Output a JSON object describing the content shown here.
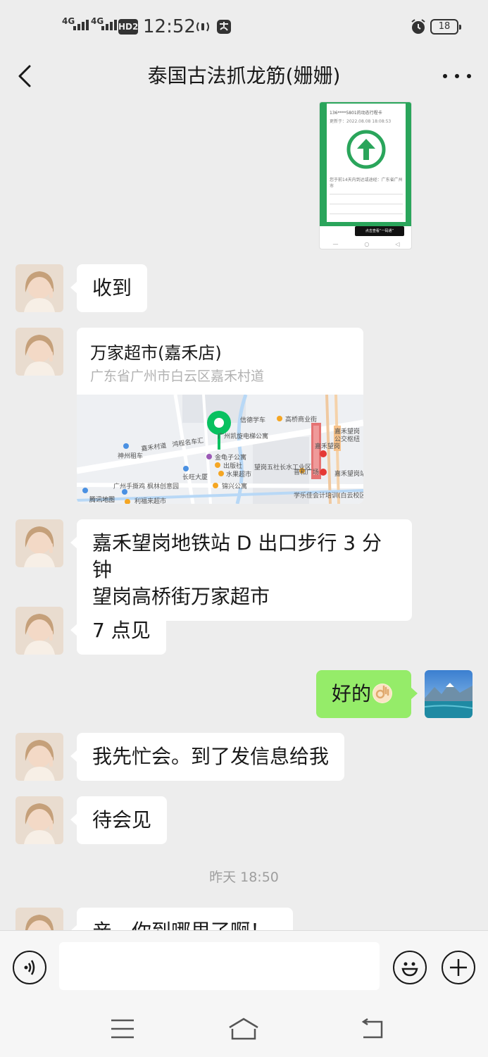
{
  "status_bar": {
    "net1": "4G",
    "net2": "4G",
    "hd": "HD2",
    "time": "12:52",
    "battery": "18"
  },
  "header": {
    "title": "泰国古法抓龙筋(姗姗)"
  },
  "image_card": {
    "line1": "136****5801的动态行程卡",
    "line2": "更新于：2022.08.08 18:08:53",
    "line3": "您于前14天内到达或途经：广东省广州市",
    "footer": "点击查看“一码通”"
  },
  "messages": {
    "m1": "收到",
    "m3": "嘉禾望岗地铁站 D 出口步行 3 分钟",
    "m3b": "望岗高桥街万家超市",
    "m4": "7 点见",
    "m5": "好的",
    "m6": "我先忙会。到了发信息给我",
    "m7": "待会见",
    "m8": "亲，你到哪里了啊！"
  },
  "location": {
    "name": "万家超市(嘉禾店)",
    "address": "广东省广州市白云区嘉禾村道",
    "map_labels": {
      "l1": "信德学车",
      "l2": "高桥商业街",
      "l3": "嘉禾望岗",
      "l4": "公交枢纽",
      "l5": "嘉禾村道",
      "l6": "鸿程名车汇",
      "l7": "神州租车",
      "l8": "广州凯旋电梯公寓",
      "l9": "金龟子公寓",
      "l10": "出版社",
      "l11": "水果超市",
      "l12": "长旺大厦",
      "l13": "望岗五社长水工业区",
      "l14": "普和广场",
      "l15": "嘉禾望岗",
      "l16": "嘉禾望岗站",
      "l17": "广州手撕鸡",
      "l18": "枫林创意园",
      "l19": "锦兴公寓",
      "l20": "利福来超市",
      "l21": "学乐佳会计培训(白云校区)",
      "brand": "腾讯地图"
    }
  },
  "timestamp": "昨天 18:50",
  "colors": {
    "background": "#ededed",
    "my_bubble": "#95ec69",
    "their_bubble": "#ffffff",
    "pin": "#07c160"
  }
}
